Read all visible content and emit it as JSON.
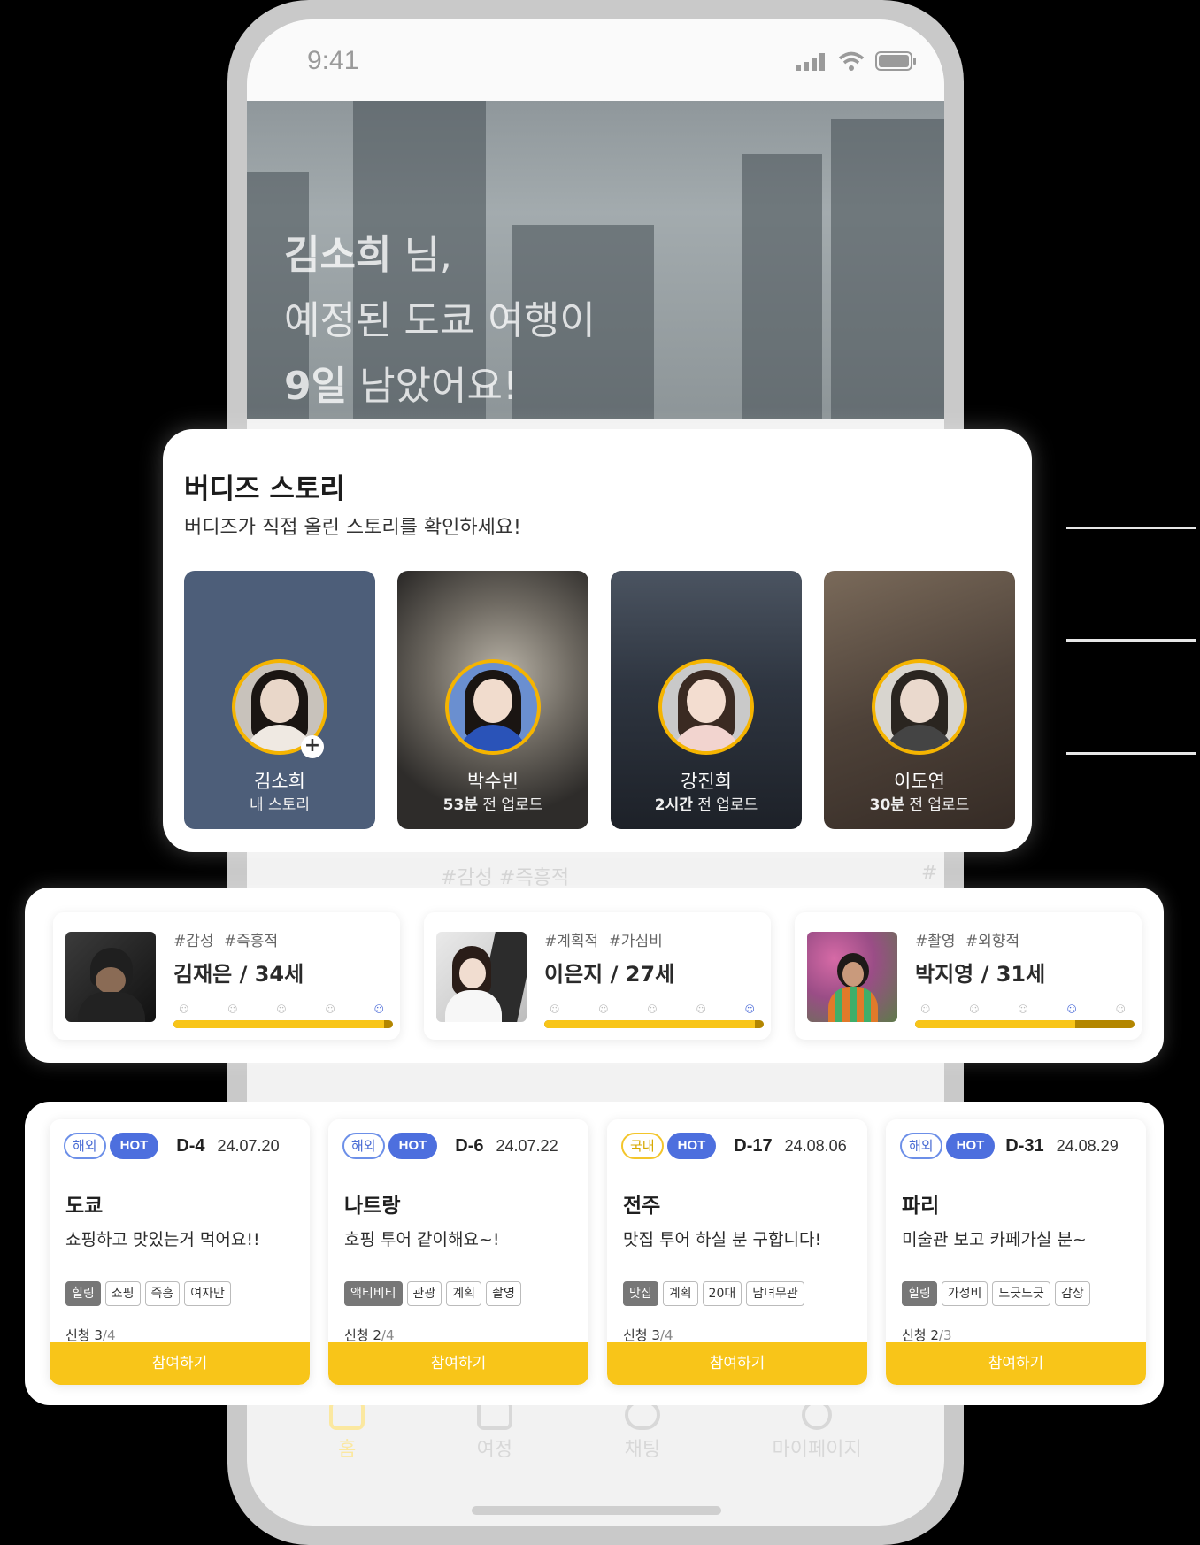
{
  "status_bar": {
    "time": "9:41"
  },
  "hero": {
    "name": "김소희",
    "honorific": " 님,",
    "line2": "예정된 도쿄 여행이",
    "days": "9일",
    "line3_rest": " 남았어요!"
  },
  "stories": {
    "title": "버디즈 스토리",
    "subtitle": "버디즈가 직접 올린 스토리를 확인하세요!",
    "items": [
      {
        "name": "김소희",
        "meta_bold": "",
        "meta": "내 스토리"
      },
      {
        "name": "박수빈",
        "meta_bold": "53분",
        "meta": " 전 업로드"
      },
      {
        "name": "강진희",
        "meta_bold": "2시간",
        "meta": " 전 업로드"
      },
      {
        "name": "이도연",
        "meta_bold": "30분",
        "meta": " 전 업로드"
      }
    ]
  },
  "background_hashtags": {
    "left": "#감성  #즉흥적",
    "right": "#ㅎ"
  },
  "buddies": [
    {
      "tags": "#감성 #즉흥적",
      "name": "김재은 / 34세",
      "match": 0.96,
      "selected_face": 5
    },
    {
      "tags": "#계획적 #가심비",
      "name": "이은지 / 27세",
      "match": 0.96,
      "selected_face": 5
    },
    {
      "tags": "#촬영 #외향적",
      "name": "박지영 / 31세",
      "match": 0.73,
      "selected_face": 4
    }
  ],
  "trips": [
    {
      "region": "해외",
      "hot": "HOT",
      "dday": "D-4",
      "date": "24.07.20",
      "city": "도쿄",
      "desc": "쇼핑하고 맛있는거 먹어요!!",
      "tags": [
        "힐링",
        "쇼핑",
        "즉흥",
        "여자만"
      ],
      "apply_label": "신청 ",
      "applied": "3",
      "total": "/4",
      "join": "참여하기"
    },
    {
      "region": "해외",
      "hot": "HOT",
      "dday": "D-6",
      "date": "24.07.22",
      "city": "나트랑",
      "desc": "호핑 투어 같이해요~!",
      "tags": [
        "액티비티",
        "관광",
        "계획",
        "촬영"
      ],
      "apply_label": "신청 ",
      "applied": "2",
      "total": "/4",
      "join": "참여하기"
    },
    {
      "region": "국내",
      "hot": "HOT",
      "dday": "D-17",
      "date": "24.08.06",
      "city": "전주",
      "desc": "맛집 투어 하실 분 구합니다!",
      "tags": [
        "맛집",
        "계획",
        "20대",
        "남녀무관"
      ],
      "apply_label": "신청 ",
      "applied": "3",
      "total": "/4",
      "join": "참여하기"
    },
    {
      "region": "해외",
      "hot": "HOT",
      "dday": "D-31",
      "date": "24.08.29",
      "city": "파리",
      "desc": "미술관 보고 카페가실 분~",
      "tags": [
        "힐링",
        "가성비",
        "느긋느긋",
        "감상"
      ],
      "apply_label": "신청 ",
      "applied": "2",
      "total": "/3",
      "join": "참여하기"
    }
  ],
  "nav": {
    "home": "홈",
    "trip": "여정",
    "chat": "채팅",
    "mypage": "마이페이지"
  },
  "colors": {
    "accent": "#F8C519",
    "hot": "#4D6FDE",
    "story_ring": "#F5B400"
  }
}
